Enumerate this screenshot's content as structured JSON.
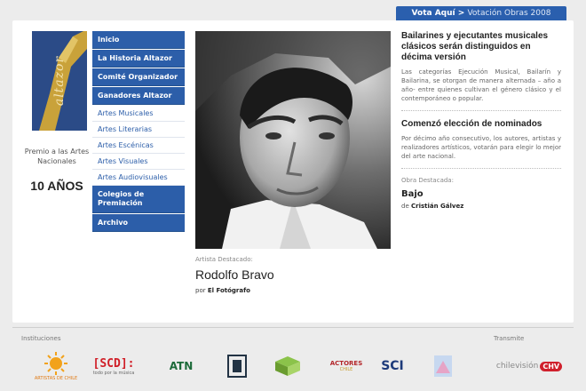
{
  "vote": {
    "primary": "Vota Aquí",
    "separator": ">",
    "secondary": "Votación Obras 2008"
  },
  "logo": {
    "word": "altazor",
    "prize": "Premio a las Artes Nacionales",
    "years": "10 AÑOS"
  },
  "nav": {
    "primary_top": [
      "Inicio",
      "La Historia Altazor",
      "Comité Organizador",
      "Ganadores Altazor"
    ],
    "sub": [
      "Artes Musicales",
      "Artes Literarias",
      "Artes Escénicas",
      "Artes Visuales",
      "Artes Audiovisuales"
    ],
    "primary_bottom": [
      "Colegios de Premiación",
      "Archivo"
    ]
  },
  "artist": {
    "kicker": "Artista Destacado:",
    "name": "Rodolfo Bravo",
    "credit_prefix": "por",
    "credit_name": "El Fotógrafo"
  },
  "news": [
    {
      "title": "Bailarines y ejecutantes musicales clásicos serán distinguidos en décima versión",
      "body": "Las categorías Ejecución Musical, Bailarín y Bailarina, se otorgan de manera alternada – año a año- entre quienes cultivan el género clásico y el contemporáneo o popular."
    },
    {
      "title": "Comenzó elección de nominados",
      "body": "Por décimo año consecutivo, los autores, artistas y realizadores artísticos, votarán para elegir lo mejor del arte nacional."
    }
  ],
  "featured_work": {
    "label": "Obra Destacada:",
    "title": "Bajo",
    "credit_prefix": "de",
    "credit_name": "Cristián Gálvez"
  },
  "sponsors": {
    "institutions_label": "Instituciones",
    "broadcast_label": "Transmite",
    "unia_caption": "ARTISTAS DE CHILE",
    "scd_main": "[SCD]:",
    "scd_sub": "todo por la música",
    "atn_main": "ATN",
    "scd2_main": "SCI",
    "chilevision": "chilevisión",
    "chv": "CHV",
    "actores_main": "ACTORES",
    "actores_sub": "CHILE"
  },
  "colors": {
    "brand_blue": "#2c5ea9",
    "vote_blue": "#2a5fae"
  }
}
